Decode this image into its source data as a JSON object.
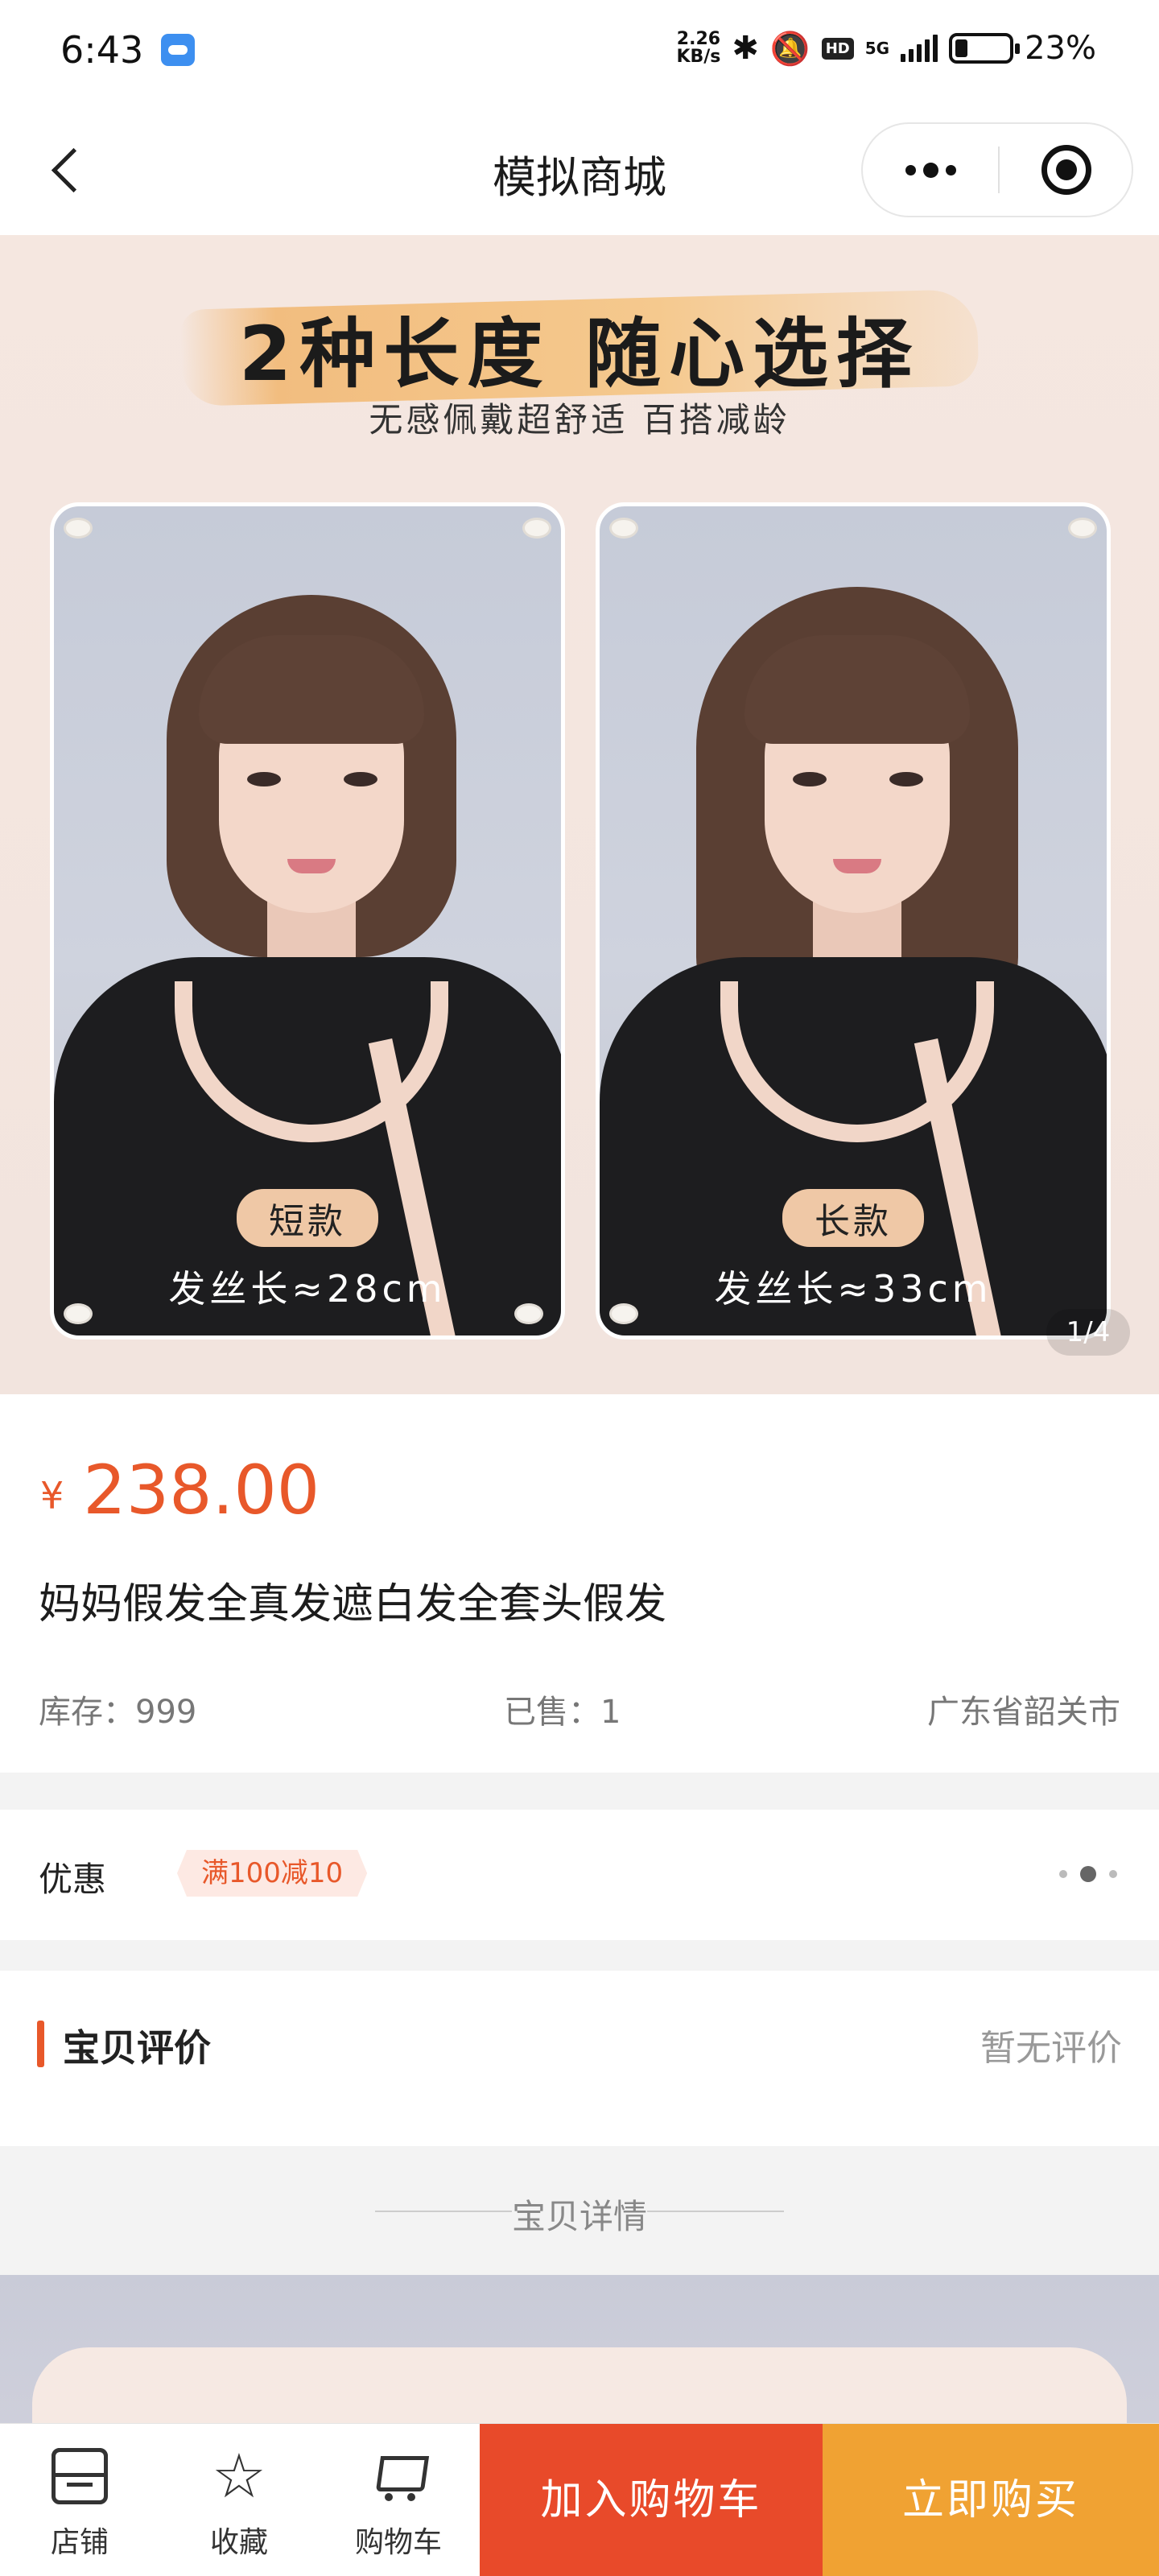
{
  "status_bar": {
    "time": "6:43",
    "net_speed_value": "2.26",
    "net_speed_unit": "KB/s",
    "network": "5G",
    "battery_percent": "23%",
    "battery_level": 0.23
  },
  "navbar": {
    "title": "模拟商城"
  },
  "banner": {
    "headline": "2种长度 随心选择",
    "subhead": "无感佩戴超舒适 百搭减龄",
    "variants": [
      {
        "tag": "短款",
        "length": "发丝长≈28cm"
      },
      {
        "tag": "长款",
        "length": "发丝长≈33cm"
      }
    ],
    "pager": "1/4"
  },
  "product": {
    "currency": "¥",
    "price": "238.00",
    "title": "妈妈假发全真发遮白发全套头假发",
    "stock": "库存：999",
    "sold": "已售：1",
    "location": "广东省韶关市"
  },
  "promo": {
    "label": "优惠",
    "coupon": "满100减10"
  },
  "review": {
    "label": "宝贝评价",
    "empty": "暂无评价"
  },
  "details": {
    "divider": "宝贝详情"
  },
  "action_bar": {
    "tabs": [
      {
        "label": "店铺",
        "icon": "store-icon"
      },
      {
        "label": "收藏",
        "icon": "star-icon"
      },
      {
        "label": "购物车",
        "icon": "cart-icon"
      }
    ],
    "add_to_cart": "加入购物车",
    "buy_now": "立即购买",
    "colors": {
      "cart": "#e84a2a",
      "buy": "#f0a233",
      "accent": "#e8582a"
    }
  }
}
